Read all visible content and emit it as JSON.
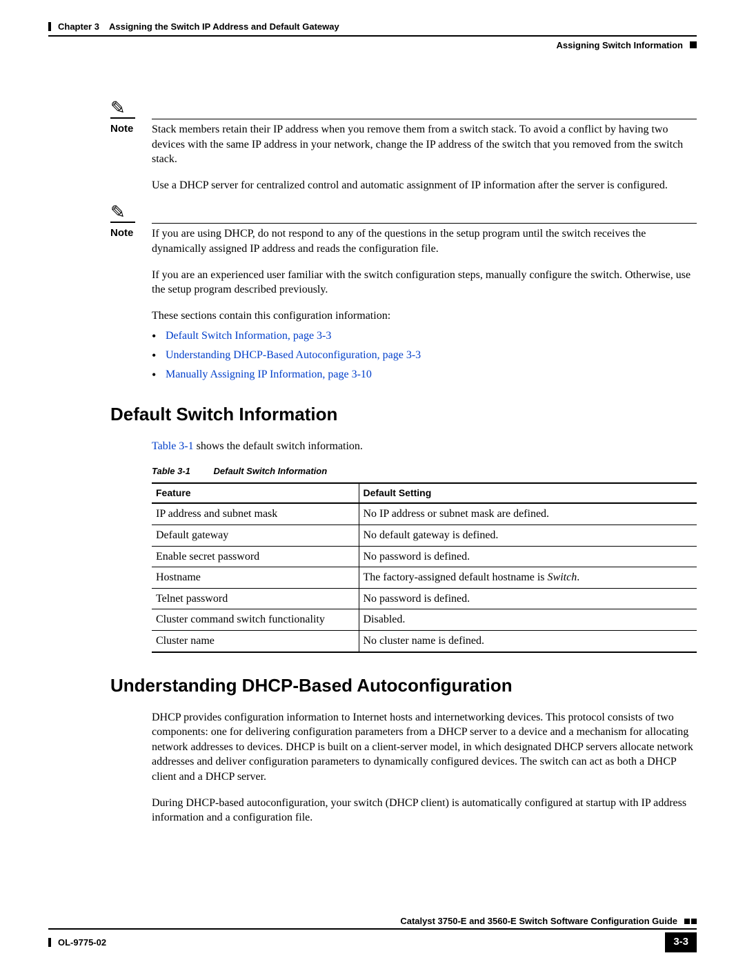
{
  "header": {
    "chapter_label": "Chapter 3",
    "chapter_title": "Assigning the Switch IP Address and Default Gateway",
    "section_title": "Assigning Switch Information"
  },
  "notes": {
    "label": "Note",
    "note1_body": "Stack members retain their IP address when you remove them from a switch stack. To avoid a conflict by having two devices with the same IP address in your network, change the IP address of the switch that you removed from the switch stack.",
    "after_note1": "Use a DHCP server for centralized control and automatic assignment of IP information after the server is configured.",
    "note2_body": "If you are using DHCP, do not respond to any of the questions in the setup program until the switch receives the dynamically assigned IP address and reads the configuration file."
  },
  "paras": {
    "p_experienced": "If you are an experienced user familiar with the switch configuration steps, manually configure the switch. Otherwise, use the setup program described previously.",
    "p_sections": "These sections contain this configuration information:"
  },
  "links": {
    "l1": "Default Switch Information, page 3-3",
    "l2": "Understanding DHCP-Based Autoconfiguration, page 3-3",
    "l3": "Manually Assigning IP Information, page 3-10"
  },
  "section1": {
    "heading": "Default Switch Information",
    "intro_pre": "Table 3-1",
    "intro_post": " shows the default switch information.",
    "table_caption_num": "Table 3-1",
    "table_caption_title": "Default Switch Information",
    "th_feature": "Feature",
    "th_setting": "Default Setting",
    "rows": [
      {
        "f": "IP address and subnet mask",
        "s": "No IP address or subnet mask are defined."
      },
      {
        "f": "Default gateway",
        "s": "No default gateway is defined."
      },
      {
        "f": "Enable secret password",
        "s": "No password is defined."
      },
      {
        "f": "Hostname",
        "s_pre": "The factory-assigned default hostname is ",
        "s_ital": "Switch",
        "s_post": "."
      },
      {
        "f": "Telnet password",
        "s": "No password is defined."
      },
      {
        "f": "Cluster command switch functionality",
        "s": "Disabled."
      },
      {
        "f": "Cluster name",
        "s": "No cluster name is defined."
      }
    ]
  },
  "section2": {
    "heading": "Understanding DHCP-Based Autoconfiguration",
    "p1": "DHCP provides configuration information to Internet hosts and internetworking devices. This protocol consists of two components: one for delivering configuration parameters from a DHCP server to a device and a mechanism for allocating network addresses to devices. DHCP is built on a client-server model, in which designated DHCP servers allocate network addresses and deliver configuration parameters to dynamically configured devices. The switch can act as both a DHCP client and a DHCP server.",
    "p2": "During DHCP-based autoconfiguration, your switch (DHCP client) is automatically configured at startup with IP address information and a configuration file."
  },
  "footer": {
    "guide_title": "Catalyst 3750-E and 3560-E Switch Software Configuration Guide",
    "doc_id": "OL-9775-02",
    "page": "3-3"
  }
}
